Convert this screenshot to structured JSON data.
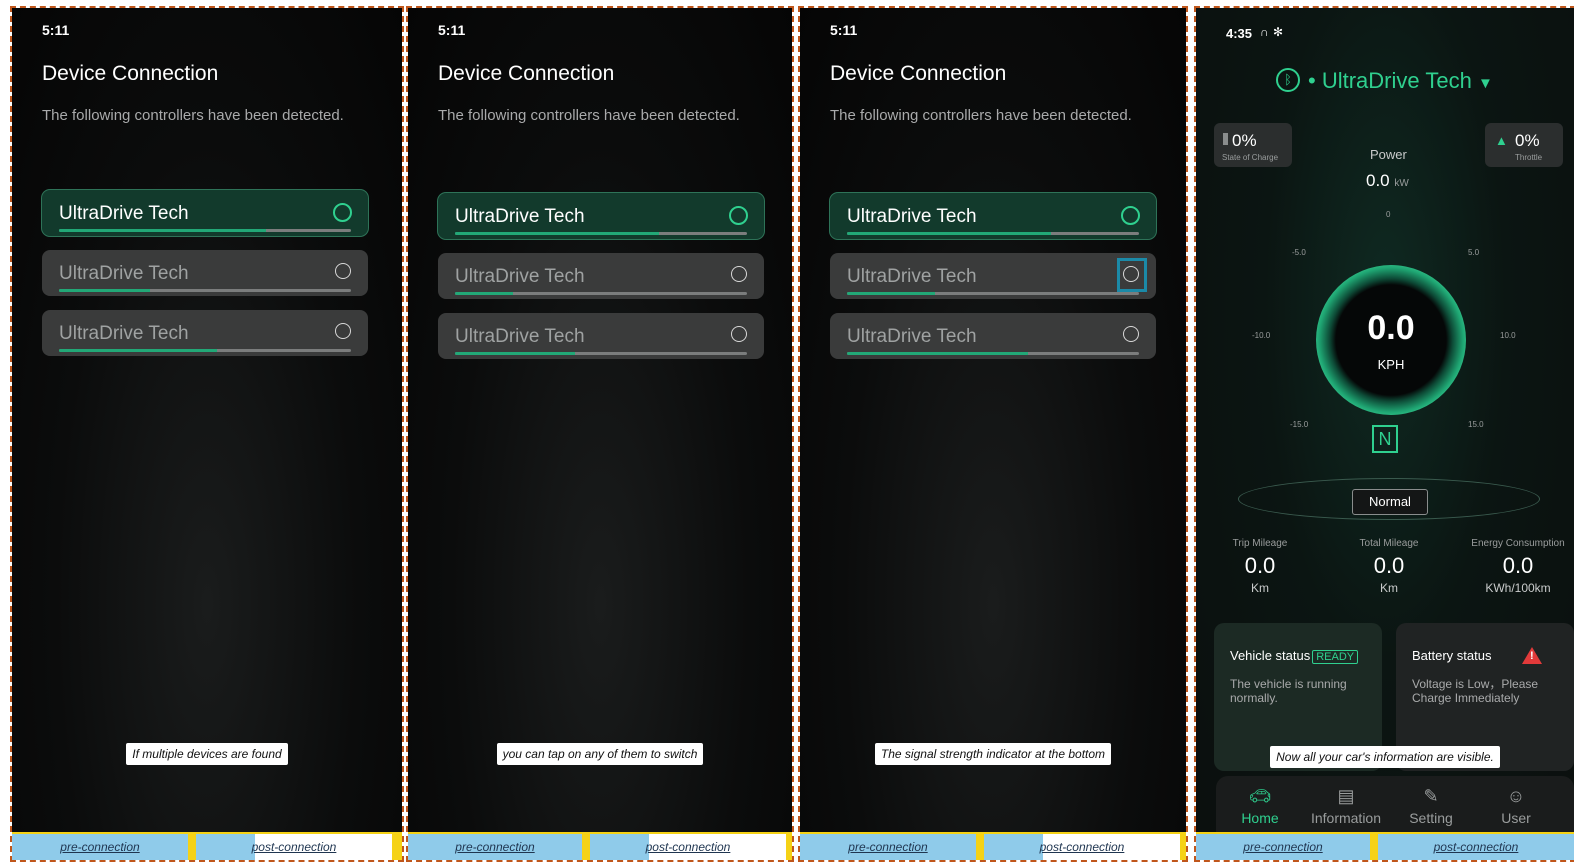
{
  "panels": [
    {
      "time": "5:11",
      "title": "Device Connection",
      "subtitle": "The following controllers have been detected.",
      "devices": [
        {
          "name": "UltraDrive Tech",
          "selected": true,
          "signal": 0.71
        },
        {
          "name": "UltraDrive Tech",
          "selected": false,
          "signal": 0.31
        },
        {
          "name": "UltraDrive Tech",
          "selected": false,
          "signal": 0.54
        }
      ],
      "caption": "If multiple devices are found"
    },
    {
      "time": "5:11",
      "title": "Device Connection",
      "subtitle": "The following controllers have been detected.",
      "devices": [
        {
          "name": "UltraDrive Tech",
          "selected": true,
          "signal": 0.7
        },
        {
          "name": "UltraDrive Tech",
          "selected": false,
          "signal": 0.2
        },
        {
          "name": "UltraDrive Tech",
          "selected": false,
          "signal": 0.41
        }
      ],
      "caption": "you can tap on any of them to switch"
    },
    {
      "time": "5:11",
      "title": "Device Connection",
      "subtitle": "The following controllers have been detected.",
      "devices": [
        {
          "name": "UltraDrive Tech",
          "selected": true,
          "signal": 0.7
        },
        {
          "name": "UltraDrive Tech",
          "selected": false,
          "signal": 0.3
        },
        {
          "name": "UltraDrive Tech",
          "selected": false,
          "signal": 0.62
        }
      ],
      "caption": "The signal strength indicator at the bottom"
    }
  ],
  "tabs": {
    "pre": "pre-connection",
    "post": "post-connection"
  },
  "dashboard": {
    "time": "4:35",
    "device": "UltraDrive Tech",
    "soc": {
      "value": "0%",
      "label": "State of Charge"
    },
    "throttle": {
      "value": "0%",
      "label": "Throttle"
    },
    "power": {
      "label": "Power",
      "value": "0.0",
      "unit": "kW"
    },
    "ticks": [
      "0",
      "-5.0",
      "5.0",
      "-10.0",
      "10.0",
      "-15.0",
      "15.0"
    ],
    "speed": {
      "value": "0.0",
      "unit": "KPH"
    },
    "gear": "N",
    "mode": "Normal",
    "stats": [
      {
        "label": "Trip Mileage",
        "value": "0.0",
        "unit": "Km"
      },
      {
        "label": "Total Mileage",
        "value": "0.0",
        "unit": "Km"
      },
      {
        "label": "Energy Consumption",
        "value": "0.0",
        "unit": "KWh/100km"
      }
    ],
    "vehicle_status": {
      "title": "Vehicle status",
      "badge": "READY",
      "text": "The vehicle is running normally."
    },
    "battery_status": {
      "title": "Battery status",
      "text": "Voltage is Low，Please Charge Immediately"
    },
    "caption": "Now all your car's information are visible.",
    "nav": [
      "Home",
      "Information",
      "Setting",
      "User"
    ]
  },
  "colors": {
    "accent": "#2fd08f",
    "highlight": "#1b8aa8",
    "warning": "#e23a3a",
    "frame": "#c0561b"
  }
}
